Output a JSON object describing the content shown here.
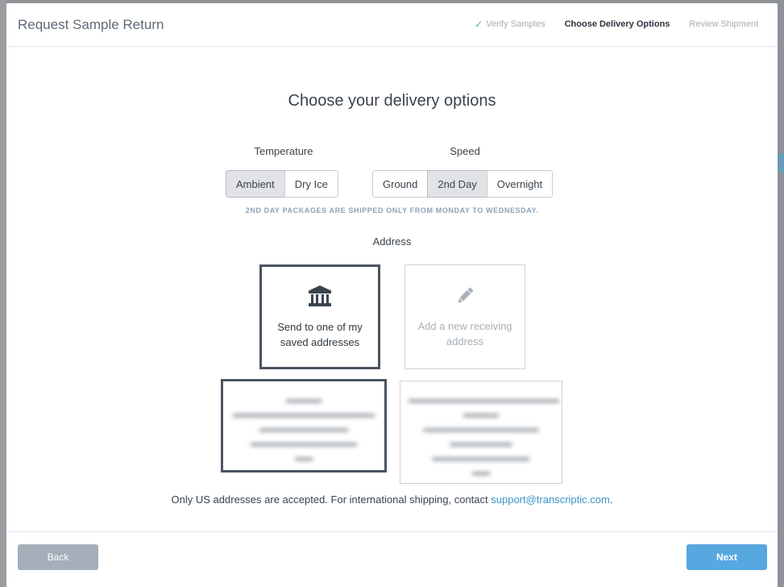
{
  "header": {
    "title": "Request Sample Return",
    "steps": [
      {
        "label": "Verify Samples",
        "state": "complete",
        "icon": "check-icon"
      },
      {
        "label": "Choose Delivery Options",
        "state": "active"
      },
      {
        "label": "Review Shipment",
        "state": "upcoming"
      }
    ]
  },
  "main": {
    "title": "Choose your delivery options",
    "temperature": {
      "label": "Temperature",
      "options": [
        "Ambient",
        "Dry Ice"
      ],
      "selected": "Ambient"
    },
    "speed": {
      "label": "Speed",
      "options": [
        "Ground",
        "2nd Day",
        "Overnight"
      ],
      "selected": "2nd Day"
    },
    "notice": "2ND DAY PACKAGES ARE SHIPPED ONLY FROM MONDAY TO WEDNESDAY.",
    "address": {
      "label": "Address",
      "saved_card": {
        "text": "Send to one of my saved addresses",
        "icon": "bank-icon",
        "selected": true
      },
      "new_card": {
        "text": "Add a new receiving address",
        "icon": "pencil-icon",
        "selected": false
      }
    },
    "footnote": {
      "text": "Only US addresses are accepted. For international shipping, contact ",
      "link": "support@transcriptic.com",
      "suffix": "."
    }
  },
  "footer": {
    "back_label": "Back",
    "next_label": "Next"
  },
  "colors": {
    "primary": "#57a7e1",
    "link": "#3d93c9",
    "check": "#5cb85c",
    "selected_border": "#4a5460"
  }
}
